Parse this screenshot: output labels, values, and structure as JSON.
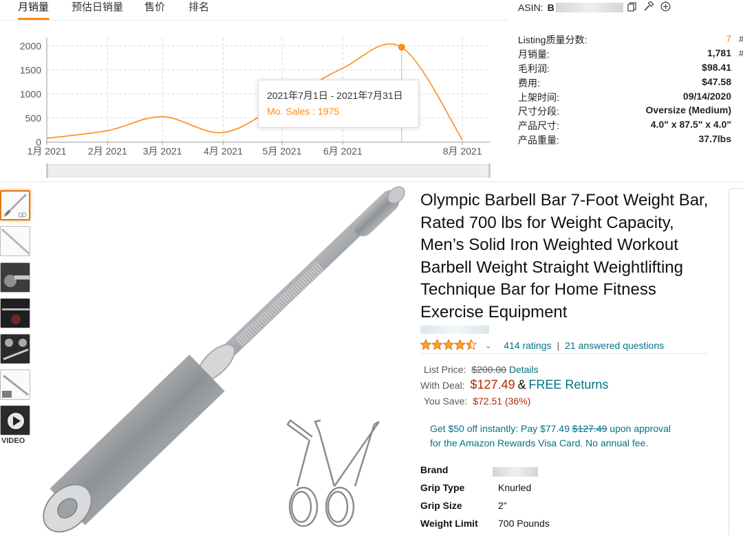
{
  "plugin": {
    "tabs": [
      "月销量",
      "预估日销量",
      "售价",
      "排名"
    ],
    "active_tab": "月销量",
    "accent_color": "#ff8a14",
    "tooltip": {
      "range": "2021年7月1日 - 2021年7月31日",
      "value": "Mo. Sales : 1975"
    },
    "info": {
      "asin_label": "ASIN:",
      "asin_prefix": "B",
      "rows": [
        {
          "key": "Listing质量分数:",
          "value": "7"
        },
        {
          "key": "月销量:",
          "value": "1,781"
        },
        {
          "key": "毛利润:",
          "value": "$98.41"
        },
        {
          "key": "费用:",
          "value": "$47.58"
        },
        {
          "key": "上架时间:",
          "value": "09/14/2020"
        },
        {
          "key": "尺寸分段:",
          "value": "Oversize (Medium)"
        },
        {
          "key": "产品尺寸:",
          "value": "4.0\" x 87.5\" x 4.0\""
        },
        {
          "key": "产品重量:",
          "value": "37.7lbs"
        }
      ],
      "edge_marks": [
        "#",
        "#"
      ],
      "icons": [
        "copy-icon",
        "hammer-icon",
        "plus-circle-icon"
      ]
    }
  },
  "chart_data": {
    "type": "line",
    "series": [
      {
        "x": [
          "2021-01-01",
          "2021-02-01",
          "2021-03-01",
          "2021-04-01",
          "2021-05-01",
          "2021-06-01",
          "2021-07-01",
          "2021-08-01"
        ],
        "values": [
          80,
          240,
          530,
          200,
          820,
          1540,
          1975,
          50
        ]
      }
    ],
    "x_tick_labels": [
      "1月 2021",
      "2月 2021",
      "3月 2021",
      "4月 2021",
      "5月 2021",
      "6月 2021",
      "8月 2021"
    ],
    "y_ticks": [
      0,
      500,
      1000,
      1500,
      2000
    ],
    "ylim": [
      0,
      2100
    ],
    "grid": true,
    "highlight_x": "2021-07-01",
    "line_color": "#ff8a14"
  },
  "product": {
    "title": "Olympic Barbell Bar 7-Foot Weight Bar, Rated 700 lbs for Weight Capacity, Men’s Solid Iron Weighted Workout Barbell Weight Straight Weightlifting Technique Bar for Home Fitness Exercise Equipment",
    "rating_stars": 4.5,
    "ratings_text": "414 ratings",
    "answered_text": "21 answered questions",
    "separator": "|",
    "list_price_label": "List Price:",
    "list_price": "$200.00",
    "details_link": "Details",
    "deal_label": "With Deal:",
    "deal_price": "$127.49",
    "amp": "&",
    "free_returns": "FREE Returns",
    "save_label": "You Save:",
    "save_value": "$72.51 (36%)",
    "promo_line1_a": "Get $50 off instantly: Pay $77.49 ",
    "promo_line1_strike": "$127.49",
    "promo_line1_b": " upon approval",
    "promo_line2": "for the Amazon Rewards Visa Card. No annual fee.",
    "specs": [
      {
        "key": "Brand",
        "value": ""
      },
      {
        "key": "Grip Type",
        "value": "Knurled"
      },
      {
        "key": "Grip Size",
        "value": "2\""
      },
      {
        "key": "Weight Limit",
        "value": "700 Pounds"
      }
    ],
    "video_label": "VIDEO",
    "price_color": "#b12704",
    "link_color": "#007185"
  }
}
